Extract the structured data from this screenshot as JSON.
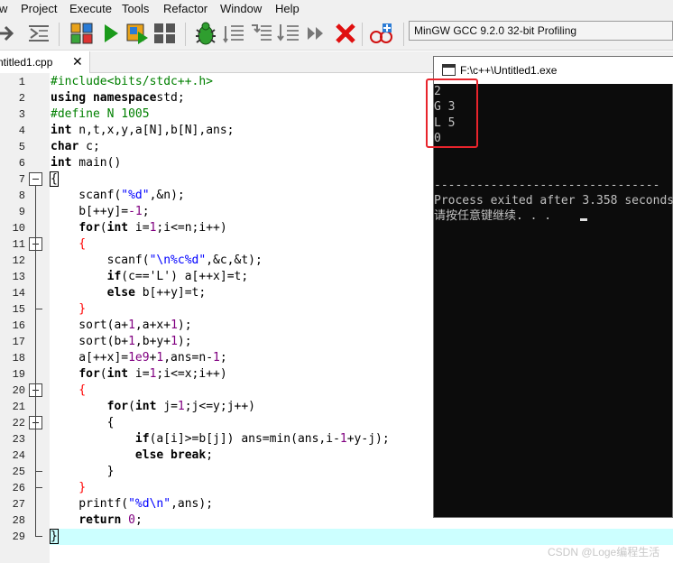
{
  "menu": [
    "w",
    "Project",
    "Execute",
    "Tools",
    "Refactor",
    "Window",
    "Help"
  ],
  "toolbar": {
    "compiler": "MinGW GCC 9.2.0 32-bit Profiling",
    "icons": [
      "arrow-right-icon",
      "indent-icon",
      "grid-4-colors-icon",
      "run-icon",
      "compile-run-icon",
      "grid-4-icon",
      "debug-bug-icon",
      "add-watch-icon",
      "next-line-icon",
      "step-into-icon",
      "skip-icon",
      "stop-icon",
      "profile-icon"
    ]
  },
  "tab": {
    "label": "ntitled1.cpp",
    "close": "✕"
  },
  "editor": {
    "line_numbers": [
      "1",
      "2",
      "3",
      "4",
      "5",
      "6",
      "7",
      "8",
      "9",
      "10",
      "11",
      "12",
      "13",
      "14",
      "15",
      "16",
      "17",
      "18",
      "19",
      "20",
      "21",
      "22",
      "23",
      "24",
      "25",
      "26",
      "27",
      "28",
      "29"
    ],
    "lines": [
      [
        [
          "pp",
          "#include<bits/stdc++.h>"
        ]
      ],
      [
        [
          "kw",
          "using namespace"
        ],
        [
          "",
          "std;"
        ]
      ],
      [
        [
          "pp",
          "#define N 1005"
        ]
      ],
      [
        [
          "kw",
          "int"
        ],
        [
          "",
          " n,t,x,y,a["
        ],
        [
          "",
          "N"
        ],
        [
          "",
          "],b["
        ],
        [
          "",
          "N"
        ],
        [
          "",
          "],ans;"
        ]
      ],
      [
        [
          "kw",
          "char"
        ],
        [
          "",
          " c;"
        ]
      ],
      [
        [
          "kw",
          "int"
        ],
        [
          "",
          " main()"
        ]
      ],
      [
        [
          "cb",
          "{"
        ]
      ],
      [
        [
          "",
          "    scanf("
        ],
        [
          "st",
          "\"%d\""
        ],
        [
          "",
          ",&n);"
        ]
      ],
      [
        [
          "",
          "    b[++y]="
        ],
        [
          "num",
          "-1"
        ],
        [
          "",
          ";"
        ]
      ],
      [
        [
          "",
          "    "
        ],
        [
          "kw",
          "for"
        ],
        [
          "",
          "("
        ],
        [
          "kw",
          "int"
        ],
        [
          "",
          " i="
        ],
        [
          "num",
          "1"
        ],
        [
          "",
          ";i<=n;i++)"
        ]
      ],
      [
        [
          "sy",
          "    {"
        ]
      ],
      [
        [
          "",
          "        scanf("
        ],
        [
          "st",
          "\"\\n%c%d\""
        ],
        [
          "",
          ",&c,&t);"
        ]
      ],
      [
        [
          "",
          "        "
        ],
        [
          "kw",
          "if"
        ],
        [
          "",
          "(c=="
        ],
        [
          "",
          "'L'"
        ],
        [
          "",
          ") a[++x]=t;"
        ]
      ],
      [
        [
          "",
          "        "
        ],
        [
          "kw",
          "else"
        ],
        [
          "",
          " b[++y]=t;"
        ]
      ],
      [
        [
          "sy",
          "    }"
        ]
      ],
      [
        [
          "",
          "    sort(a+"
        ],
        [
          "num",
          "1"
        ],
        [
          "",
          ",a+x+"
        ],
        [
          "num",
          "1"
        ],
        [
          "",
          ");"
        ]
      ],
      [
        [
          "",
          "    sort(b+"
        ],
        [
          "num",
          "1"
        ],
        [
          "",
          ",b+y+"
        ],
        [
          "num",
          "1"
        ],
        [
          "",
          ");"
        ]
      ],
      [
        [
          "",
          "    a[++x]="
        ],
        [
          "num",
          "1e9"
        ],
        [
          "",
          "+"
        ],
        [
          "num",
          "1"
        ],
        [
          "",
          ",ans=n-"
        ],
        [
          "num",
          "1"
        ],
        [
          "",
          ";"
        ]
      ],
      [
        [
          "",
          "    "
        ],
        [
          "kw",
          "for"
        ],
        [
          "",
          "("
        ],
        [
          "kw",
          "int"
        ],
        [
          "",
          " i="
        ],
        [
          "num",
          "1"
        ],
        [
          "",
          ";i<=x;i++)"
        ]
      ],
      [
        [
          "sy",
          "    {"
        ]
      ],
      [
        [
          "",
          "        "
        ],
        [
          "kw",
          "for"
        ],
        [
          "",
          "("
        ],
        [
          "kw",
          "int"
        ],
        [
          "",
          " j="
        ],
        [
          "num",
          "1"
        ],
        [
          "",
          ";j<=y;j++)"
        ]
      ],
      [
        [
          "",
          "        {"
        ]
      ],
      [
        [
          "",
          "            "
        ],
        [
          "kw",
          "if"
        ],
        [
          "",
          "(a[i]>=b[j]) ans=min(ans,i-"
        ],
        [
          "num",
          "1"
        ],
        [
          "",
          "+y-j);"
        ]
      ],
      [
        [
          "",
          "            "
        ],
        [
          "kw",
          "else break"
        ],
        [
          "",
          ";"
        ]
      ],
      [
        [
          "",
          "        }"
        ]
      ],
      [
        [
          "sy",
          "    }"
        ]
      ],
      [
        [
          "",
          "    printf("
        ],
        [
          "st",
          "\"%d\\n\""
        ],
        [
          "",
          ",ans);"
        ]
      ],
      [
        [
          "",
          "    "
        ],
        [
          "kw",
          "return"
        ],
        [
          "",
          " "
        ],
        [
          "num",
          "0"
        ],
        [
          "",
          ";"
        ]
      ],
      [
        [
          "cb",
          "}"
        ]
      ]
    ]
  },
  "console": {
    "title": "F:\\c++\\Untitled1.exe",
    "lines": [
      "2",
      "G 3",
      "L 5",
      "0",
      "",
      "",
      "--------------------------------",
      "Process exited after 3.358 seconds",
      "请按任意键继续. . . "
    ]
  },
  "watermark": "CSDN @Loge编程生活"
}
